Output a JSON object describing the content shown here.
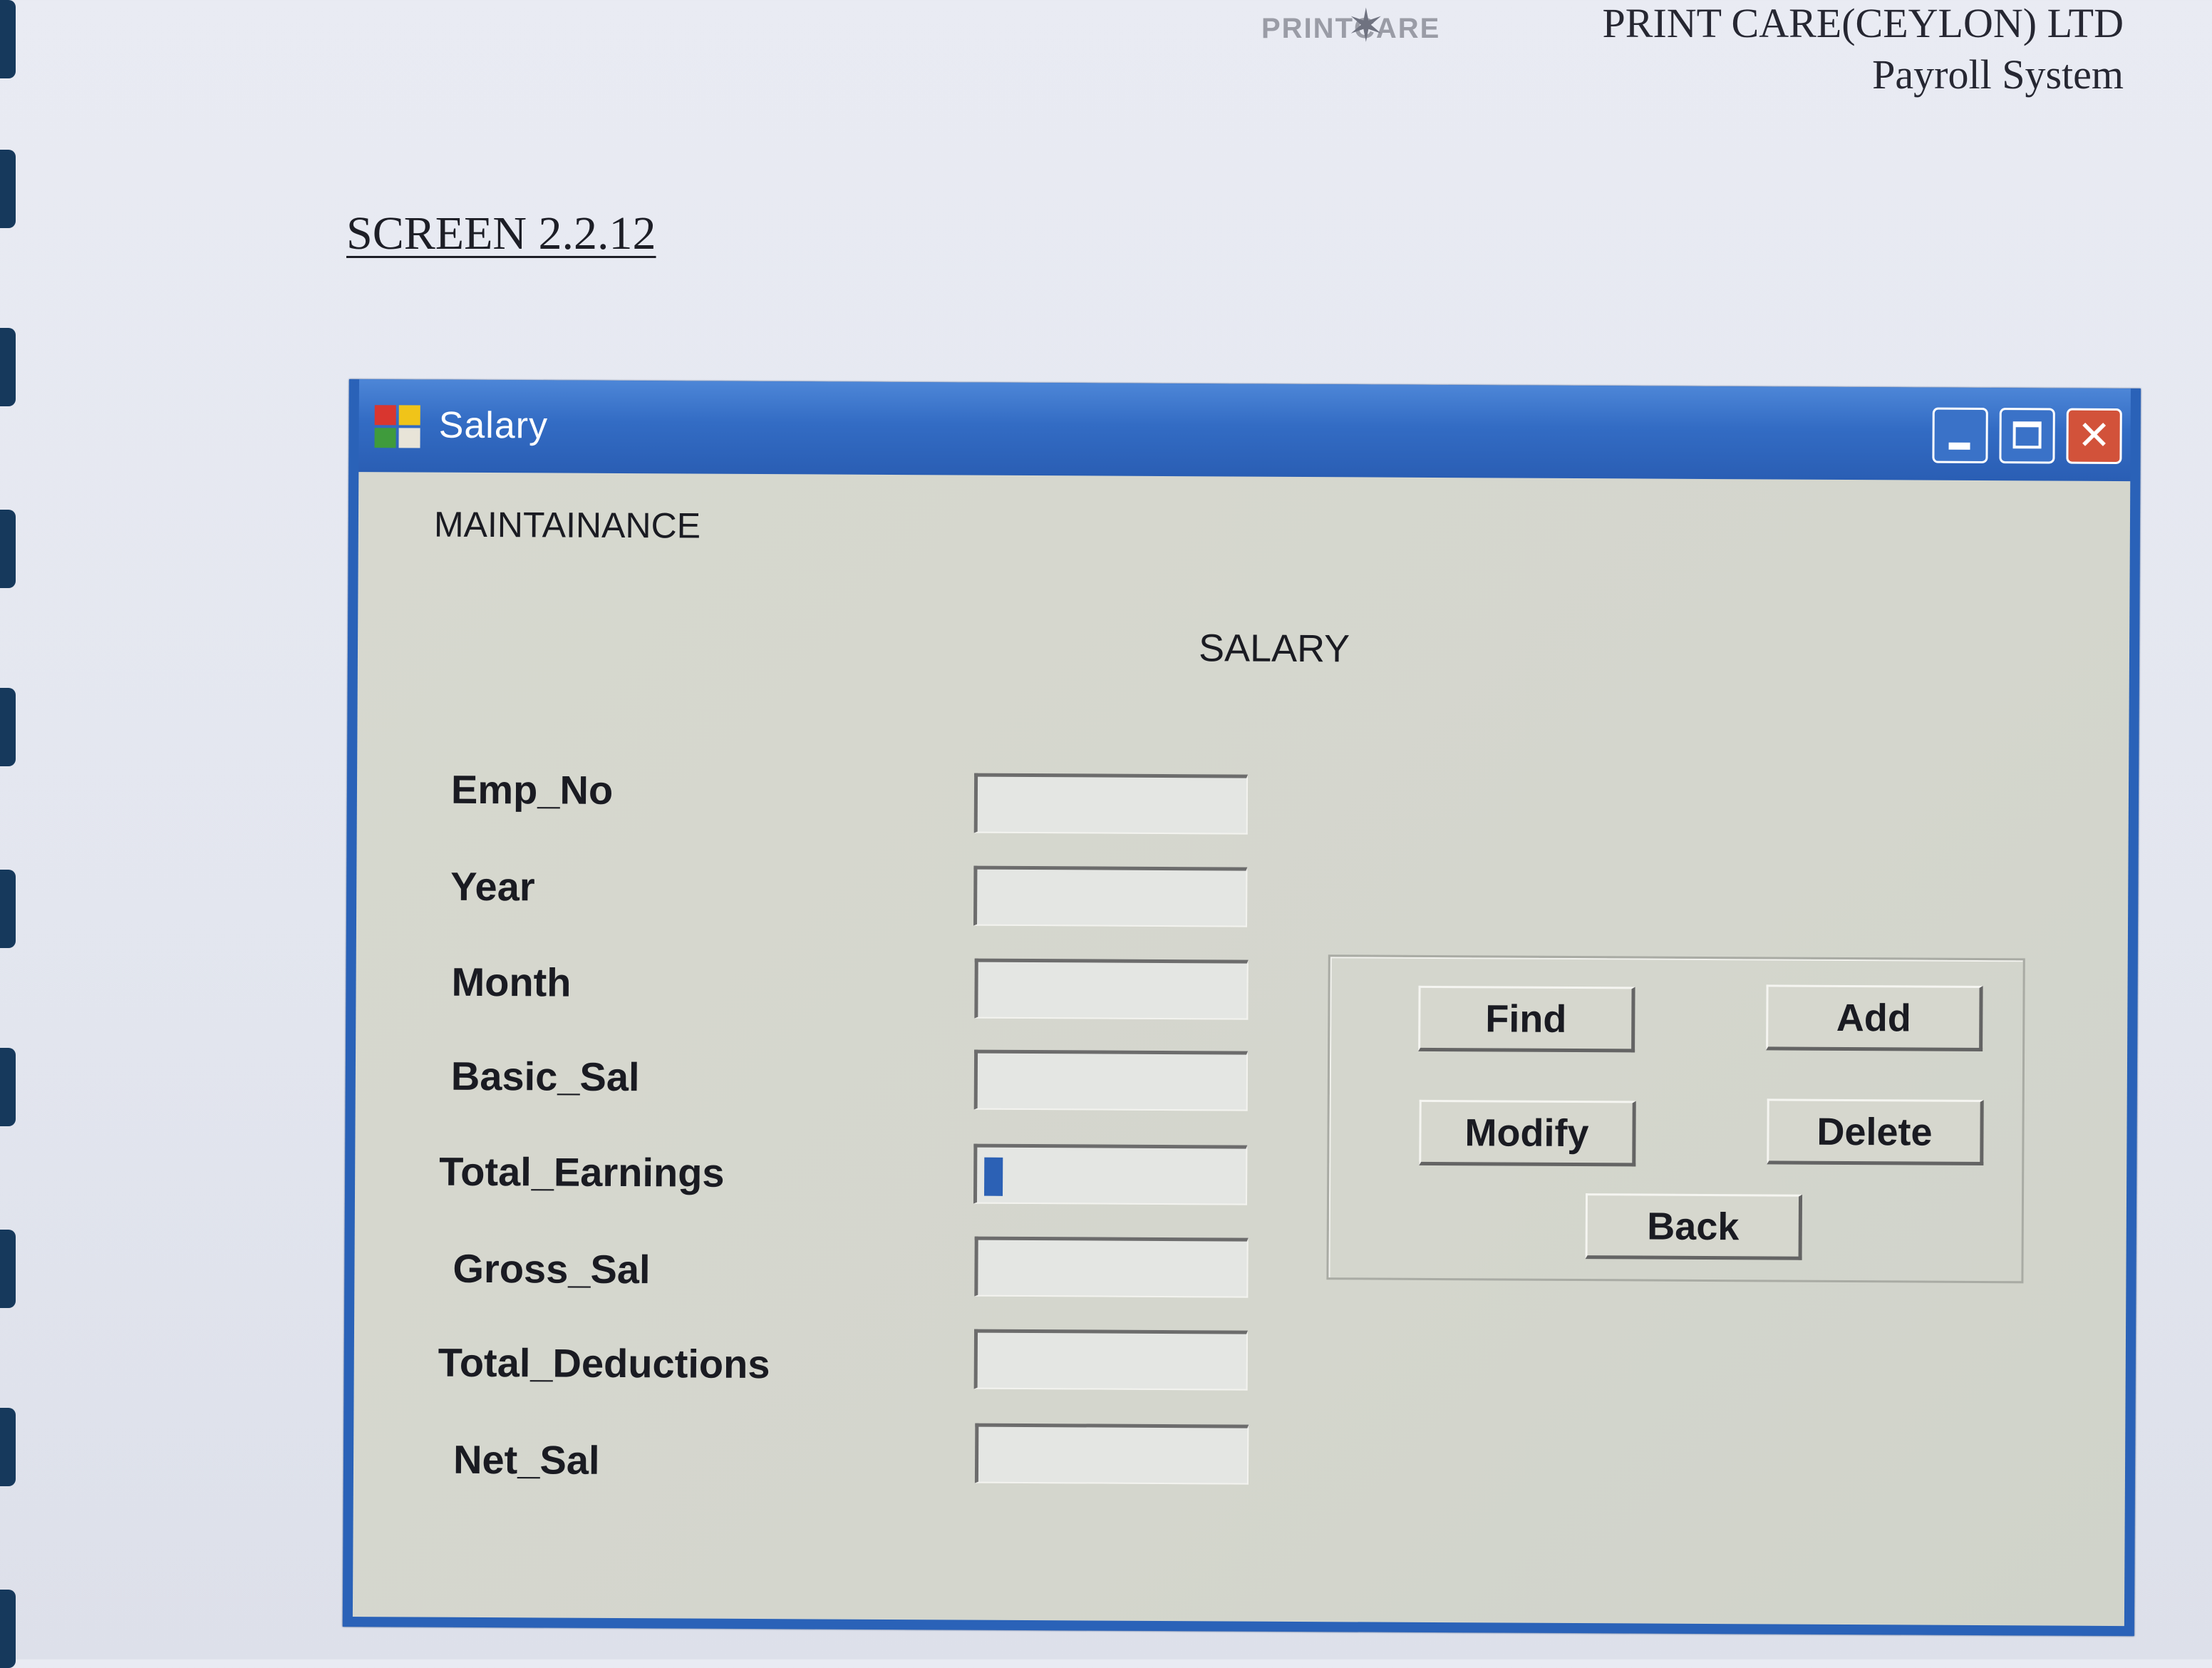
{
  "document": {
    "logo_text": "PRINTCARE",
    "company": "PRINT CARE(CEYLON) LTD",
    "system": "Payroll System",
    "screen_label": "SCREEN 2.2.12"
  },
  "window": {
    "title": "Salary",
    "controls": {
      "minimize": "_",
      "maximize": "□",
      "close": "✕"
    }
  },
  "form": {
    "menu_label": "MAINTAINANCE",
    "title": "SALARY",
    "fields": [
      {
        "label": "Emp_No",
        "value": ""
      },
      {
        "label": "Year",
        "value": ""
      },
      {
        "label": "Month",
        "value": ""
      },
      {
        "label": "Basic_Sal",
        "value": ""
      },
      {
        "label": "Total_Earnings",
        "value": ""
      },
      {
        "label": "Gross_Sal",
        "value": ""
      },
      {
        "label": "Total_Deductions",
        "value": ""
      },
      {
        "label": "Net_Sal",
        "value": ""
      }
    ],
    "buttons": {
      "find": "Find",
      "add": "Add",
      "modify": "Modify",
      "delete": "Delete",
      "back": "Back"
    }
  },
  "colors": {
    "titlebar": "#336cc4",
    "window_border": "#2a62b8",
    "client_bg": "#d6d7ce",
    "close_button": "#d2523a"
  }
}
